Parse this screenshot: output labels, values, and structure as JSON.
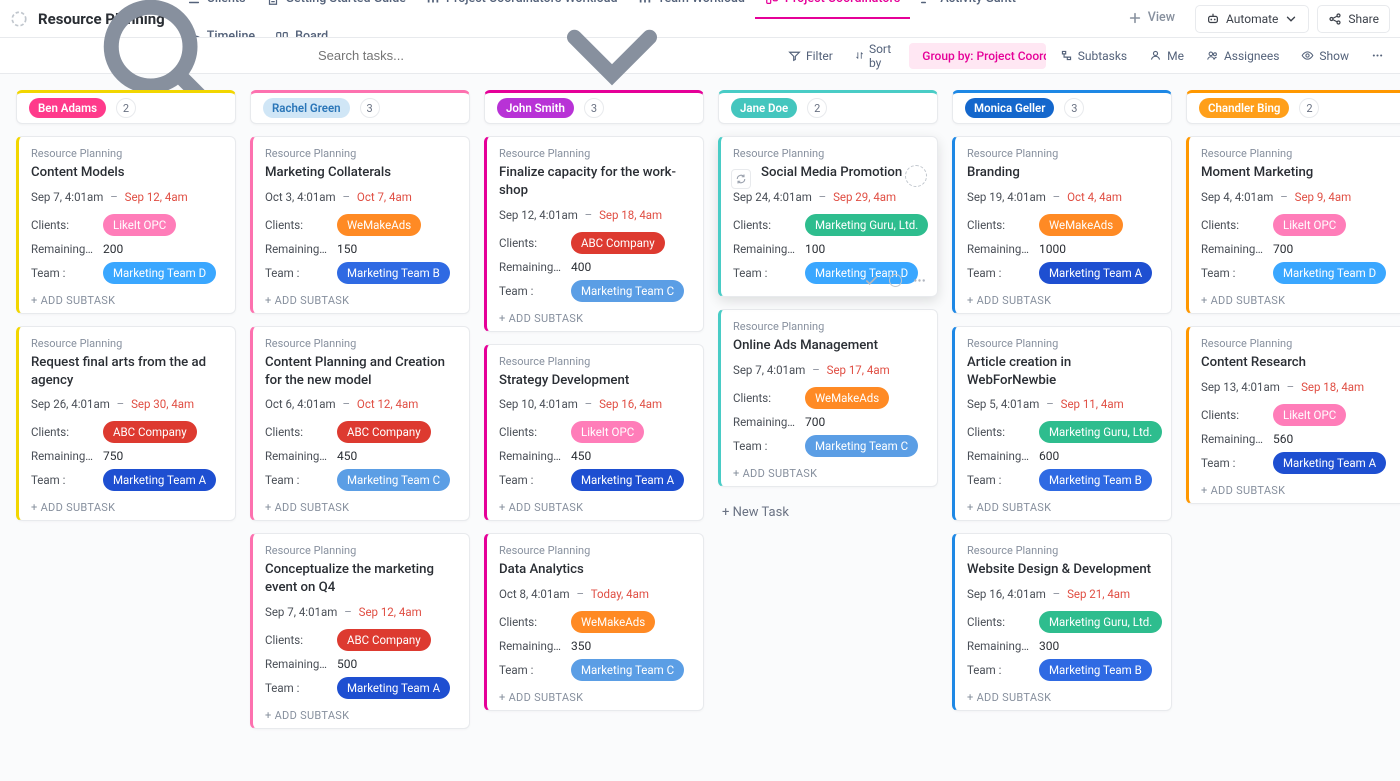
{
  "header": {
    "title": "Resource Planning",
    "views": [
      {
        "id": "clients",
        "label": "Clients",
        "icon": "list"
      },
      {
        "id": "guide",
        "label": "Getting Started Guide",
        "icon": "doc"
      },
      {
        "id": "pc-workload",
        "label": "Project Coordinators Workload",
        "icon": "workload"
      },
      {
        "id": "team-workload",
        "label": "Team Workload",
        "icon": "workload"
      },
      {
        "id": "pc",
        "label": "Project Coordinators",
        "icon": "board",
        "active": true
      },
      {
        "id": "activity-gantt",
        "label": "Activity Gantt",
        "icon": "gantt"
      },
      {
        "id": "timeline",
        "label": "Timeline",
        "icon": "timeline"
      },
      {
        "id": "board",
        "label": "Board",
        "icon": "board"
      }
    ],
    "add_view_label": "View",
    "automate_label": "Automate",
    "share_label": "Share"
  },
  "filterbar": {
    "search_placeholder": "Search tasks...",
    "filter": "Filter",
    "sortby": "Sort by",
    "groupby": "Group by: Project Coordin...",
    "subtasks": "Subtasks",
    "me": "Me",
    "assignees": "Assignees",
    "show": "Show"
  },
  "labels": {
    "crumb": "Resource Planning",
    "clients": "Clients:",
    "remaining": "Remaining ...",
    "team": "Team :",
    "add_subtask": "+ ADD SUBTASK",
    "new_task": "+ New Task"
  },
  "columns": [
    {
      "name": "Ben Adams",
      "name_class": "name-ben",
      "bar_class": "bar-yellow",
      "count": 2,
      "cards": [
        {
          "title": "Content Models",
          "start": "Sep 7, 4:01am",
          "end": "Sep 12, 4am",
          "client": {
            "label": "LikeIt OPC",
            "cls": "c-likeit"
          },
          "remaining": "200",
          "team": {
            "label": "Marketing Team D",
            "cls": "t-d"
          }
        },
        {
          "title": "Request final arts from the ad agency",
          "start": "Sep 26, 4:01am",
          "end": "Sep 30, 4am",
          "client": {
            "label": "ABC Company",
            "cls": "c-abc"
          },
          "remaining": "750",
          "team": {
            "label": "Marketing Team A",
            "cls": "t-a"
          }
        }
      ]
    },
    {
      "name": "Rachel Green",
      "name_class": "name-rachel",
      "bar_class": "bar-pink",
      "count": 3,
      "cards": [
        {
          "title": "Marketing Collaterals",
          "start": "Oct 3, 4:01am",
          "end": "Oct 7, 4am",
          "client": {
            "label": "WeMakeAds",
            "cls": "c-wemakeads"
          },
          "remaining": "150",
          "team": {
            "label": "Marketing Team B",
            "cls": "t-b"
          }
        },
        {
          "title": "Content Planning and Creation for the new model",
          "start": "Oct 6, 4:01am",
          "end": "Oct 12, 4am",
          "client": {
            "label": "ABC Company",
            "cls": "c-abc"
          },
          "remaining": "450",
          "team": {
            "label": "Marketing Team C",
            "cls": "t-c"
          }
        },
        {
          "title": "Conceptualize the marketing event on Q4",
          "start": "Sep 7, 4:01am",
          "end": "Sep 12, 4am",
          "client": {
            "label": "ABC Company",
            "cls": "c-abc"
          },
          "remaining": "500",
          "team": {
            "label": "Marketing Team A",
            "cls": "t-a"
          }
        }
      ]
    },
    {
      "name": "John Smith",
      "name_class": "name-john",
      "bar_class": "bar-magenta",
      "count": 3,
      "cards": [
        {
          "title": "Finalize capacity for the work­shop",
          "start": "Sep 12, 4:01am",
          "end": "Sep 18, 4am",
          "client": {
            "label": "ABC Company",
            "cls": "c-abc"
          },
          "remaining": "400",
          "team": {
            "label": "Marketing Team C",
            "cls": "t-c"
          }
        },
        {
          "title": "Strategy Development",
          "start": "Sep 10, 4:01am",
          "end": "Sep 16, 4am",
          "client": {
            "label": "LikeIt OPC",
            "cls": "c-likeit"
          },
          "remaining": "450",
          "team": {
            "label": "Marketing Team A",
            "cls": "t-a"
          }
        },
        {
          "title": "Data Analytics",
          "start": "Oct 8, 4:01am",
          "end": "Today, 4am",
          "client": {
            "label": "WeMakeAds",
            "cls": "c-wemakeads"
          },
          "remaining": "350",
          "team": {
            "label": "Marketing Team C",
            "cls": "t-c"
          }
        }
      ]
    },
    {
      "name": "Jane Doe",
      "name_class": "name-jane",
      "bar_class": "bar-cyan",
      "count": 2,
      "cards": [
        {
          "title": "Social Media Promotion",
          "start": "Sep 24, 4:01am",
          "end": "Sep 29, 4am",
          "client": {
            "label": "Marketing Guru, Ltd.",
            "cls": "c-guru"
          },
          "remaining": "100",
          "team": {
            "label": "Marketing Team D",
            "cls": "t-d"
          },
          "hovered": true
        },
        {
          "title": "Online Ads Management",
          "start": "Sep 7, 4:01am",
          "end": "Sep 17, 4am",
          "client": {
            "label": "WeMakeAds",
            "cls": "c-wemakeads"
          },
          "remaining": "700",
          "team": {
            "label": "Marketing Team C",
            "cls": "t-c"
          }
        }
      ],
      "show_new_task": true
    },
    {
      "name": "Monica Geller",
      "name_class": "name-monica",
      "bar_class": "bar-blue",
      "count": 3,
      "cards": [
        {
          "title": "Branding",
          "start": "Sep 19, 4:01am",
          "end": "Oct 4, 4am",
          "client": {
            "label": "WeMakeAds",
            "cls": "c-wemakeads"
          },
          "remaining": "1000",
          "team": {
            "label": "Marketing Team A",
            "cls": "t-a"
          }
        },
        {
          "title": "Article creation in WebForNewbie",
          "start": "Sep 5, 4:01am",
          "end": "Sep 11, 4am",
          "client": {
            "label": "Marketing Guru, Ltd.",
            "cls": "c-guru"
          },
          "remaining": "600",
          "team": {
            "label": "Marketing Team B",
            "cls": "t-b"
          }
        },
        {
          "title": "Website Design & Development",
          "start": "Sep 16, 4:01am",
          "end": "Sep 21, 4am",
          "client": {
            "label": "Marketing Guru, Ltd.",
            "cls": "c-guru"
          },
          "remaining": "300",
          "team": {
            "label": "Marketing Team B",
            "cls": "t-b"
          }
        }
      ]
    },
    {
      "name": "Chandler Bing",
      "name_class": "name-chandler",
      "bar_class": "bar-orange",
      "count": 2,
      "cards": [
        {
          "title": "Moment Marketing",
          "start": "Sep 4, 4:01am",
          "end": "Sep 9, 4am",
          "client": {
            "label": "LikeIt OPC",
            "cls": "c-likeit"
          },
          "remaining": "700",
          "team": {
            "label": "Marketing Team D",
            "cls": "t-d"
          }
        },
        {
          "title": "Content Research",
          "start": "Sep 13, 4:01am",
          "end": "Sep 18, 4am",
          "client": {
            "label": "LikeIt OPC",
            "cls": "c-likeit"
          },
          "remaining": "560",
          "team": {
            "label": "Marketing Team A",
            "cls": "t-a"
          }
        }
      ]
    }
  ]
}
